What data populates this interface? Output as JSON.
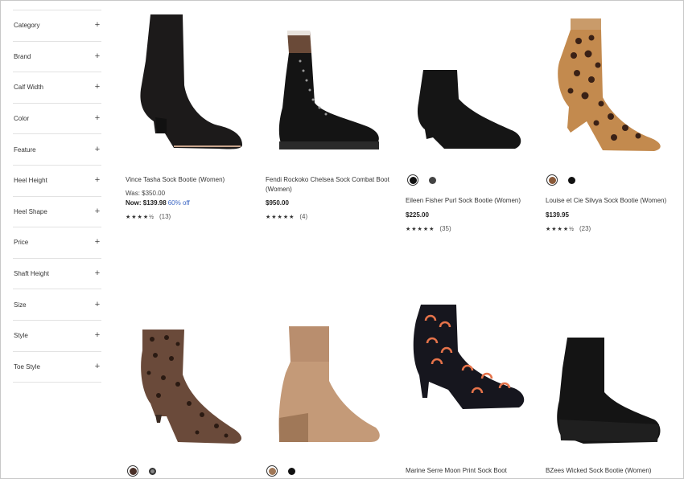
{
  "filters": [
    {
      "label": "Category"
    },
    {
      "label": "Brand"
    },
    {
      "label": "Calf Width"
    },
    {
      "label": "Color"
    },
    {
      "label": "Feature"
    },
    {
      "label": "Heel Height"
    },
    {
      "label": "Heel Shape"
    },
    {
      "label": "Price"
    },
    {
      "label": "Shaft Height"
    },
    {
      "label": "Size"
    },
    {
      "label": "Style"
    },
    {
      "label": "Toe Style"
    }
  ],
  "filter_icon": "+",
  "products": [
    {
      "name": "Vince Tasha Sock Bootie (Women)",
      "was": "Was: $350.00",
      "now": "Now: $139.98",
      "off": "60% off",
      "stars": "★★★★½",
      "count": "(13)"
    },
    {
      "name_line1": "Fendi Rockoko Chelsea Sock Combat Boot",
      "name_line2": "(Women)",
      "price": "$950.00",
      "stars": "★★★★★",
      "count": "(4)"
    },
    {
      "name": "Eileen Fisher Purl Sock Bootie (Women)",
      "price": "$225.00",
      "stars": "★★★★★",
      "count": "(35)"
    },
    {
      "name": "Louise et Cie Silvya Sock Bootie (Women)",
      "price": "$139.95",
      "stars": "★★★★½",
      "count": "(23)"
    },
    {
      "name": ""
    },
    {
      "name": ""
    },
    {
      "name": "Marine Serre Moon Print Sock Boot"
    },
    {
      "name": "BZees Wicked Sock Bootie (Women)"
    }
  ]
}
